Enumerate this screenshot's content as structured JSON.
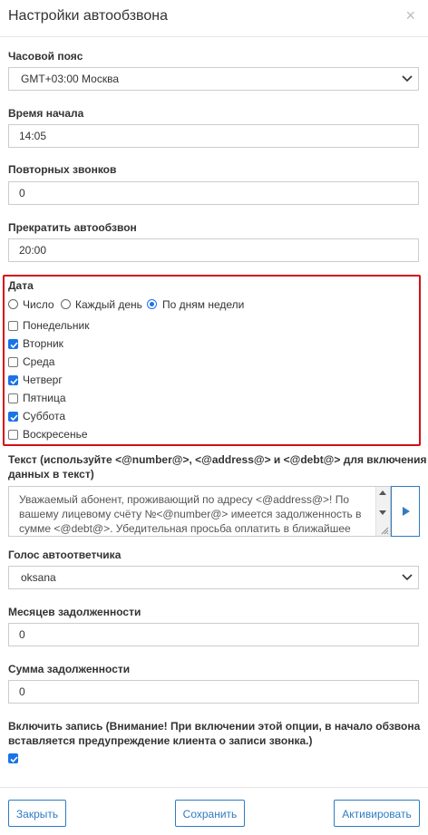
{
  "header": {
    "title": "Настройки автообзвона",
    "close_symbol": "×"
  },
  "timezone": {
    "label": "Часовой пояс",
    "value": "GMT+03:00 Москва"
  },
  "start_time": {
    "label": "Время начала",
    "value": "14:05"
  },
  "repeat_calls": {
    "label": "Повторных звонков",
    "value": "0"
  },
  "stop_time": {
    "label": "Прекратить автообзвон",
    "value": "20:00"
  },
  "date": {
    "label": "Дата",
    "modes": [
      {
        "label": "Число",
        "selected": false
      },
      {
        "label": "Каждый день",
        "selected": false
      },
      {
        "label": "По дням недели",
        "selected": true
      }
    ],
    "days": [
      {
        "label": "Понедельник",
        "checked": false
      },
      {
        "label": "Вторник",
        "checked": true
      },
      {
        "label": "Среда",
        "checked": false
      },
      {
        "label": "Четверг",
        "checked": true
      },
      {
        "label": "Пятница",
        "checked": false
      },
      {
        "label": "Суббота",
        "checked": true
      },
      {
        "label": "Воскресенье",
        "checked": false
      }
    ]
  },
  "text": {
    "label_line1": "Текст (используйте <@number@>, <@address@> и <@debt@> для включения",
    "label_line2": "данных в текст)",
    "value": "Уважаемый абонент, проживающий по адресу <@address@>!  По вашему лицевому счёту №<@number@> имеется задолженность в сумме <@debt@>. Убедительная просьба оплатить в ближайшее время!"
  },
  "voice": {
    "label": "Голос автоответчика",
    "value": "oksana"
  },
  "debt_months": {
    "label": "Месяцев задолженности",
    "value": "0"
  },
  "debt_sum": {
    "label": "Сумма задолженности",
    "value": "0"
  },
  "record": {
    "label_line1": "Включить запись (Внимание! При включении этой опции, в начало обзвона",
    "label_line2": "вставляется предупреждение клиента о записи звонка.)",
    "checked": true
  },
  "footer": {
    "close_label": "Закрыть",
    "save_label": "Сохранить",
    "activate_label": "Активировать"
  },
  "colors": {
    "accent": "#1a73e8",
    "button_border": "#2f7bc4",
    "highlight": "#d30f15"
  }
}
